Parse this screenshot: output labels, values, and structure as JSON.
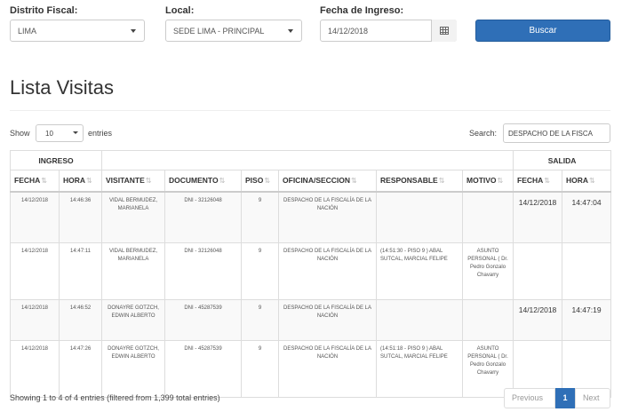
{
  "filters": {
    "distrito_label": "Distrito Fiscal:",
    "distrito_value": "LIMA",
    "local_label": "Local:",
    "local_value": "SEDE LIMA - PRINCIPAL",
    "fecha_label": "Fecha de Ingreso:",
    "fecha_value": "14/12/2018",
    "buscar_label": "Buscar"
  },
  "page_title": "Lista Visitas",
  "controls": {
    "show_label": "Show",
    "page_length": "10",
    "entries_label": "entries",
    "search_label": "Search:",
    "search_value": "DESPACHO DE LA FISCA"
  },
  "table": {
    "group_ingreso": "INGRESO",
    "group_salida": "SALIDA",
    "columns": [
      "FECHA",
      "HORA",
      "VISITANTE",
      "DOCUMENTO",
      "PISO",
      "OFICINA/SECCION",
      "RESPONSABLE",
      "MOTIVO",
      "FECHA",
      "HORA"
    ],
    "rows": [
      {
        "fecha": "14/12/2018",
        "hora": "14:46:36",
        "visitante": "VIDAL BERMUDEZ, MARIANELA",
        "documento": "DNI - 32126048",
        "piso": "9",
        "oficina": "DESPACHO DE LA FISCALÍA DE LA NACIÓN",
        "responsable": "",
        "motivo": "",
        "salida_fecha": "14/12/2018",
        "salida_hora": "14:47:04"
      },
      {
        "fecha": "14/12/2018",
        "hora": "14:47:11",
        "visitante": "VIDAL BERMUDEZ, MARIANELA",
        "documento": "DNI - 32126048",
        "piso": "9",
        "oficina": "DESPACHO DE LA FISCALÍA DE LA NACIÓN",
        "responsable": "(14:51:30 - PISO 9 ) ABAL SUTCAL, MARCIAL FELIPE",
        "motivo": "ASUNTO PERSONAL ( Dr. Pedro Gonzalo Chavarry",
        "salida_fecha": "",
        "salida_hora": ""
      },
      {
        "fecha": "14/12/2018",
        "hora": "14:46:52",
        "visitante": "DONAYRE GOTZCH, EDWIN ALBERTO",
        "documento": "DNI - 45287539",
        "piso": "9",
        "oficina": "DESPACHO DE LA FISCALÍA DE LA NACIÓN",
        "responsable": "",
        "motivo": "",
        "salida_fecha": "14/12/2018",
        "salida_hora": "14:47:19"
      },
      {
        "fecha": "14/12/2018",
        "hora": "14:47:26",
        "visitante": "DONAYRE GOTZCH, EDWIN ALBERTO",
        "documento": "DNI - 45287539",
        "piso": "9",
        "oficina": "DESPACHO DE LA FISCALÍA DE LA NACIÓN",
        "responsable": "(14:51:18 - PISO 9 ) ABAL SUTCAL, MARCIAL FELIPE",
        "motivo": "ASUNTO PERSONAL ( Dr. Pedro Gonzalo Chavarry",
        "salida_fecha": "",
        "salida_hora": ""
      }
    ]
  },
  "footer": {
    "info": "Showing 1 to 4 of 4 entries (filtered from 1,399 total entries)",
    "prev_label": "Previous",
    "current_page": "1",
    "next_label": "Next"
  },
  "colors": {
    "primary": "#2f6fb7",
    "stripe": "#f9f9f9",
    "border": "#dddddd"
  }
}
